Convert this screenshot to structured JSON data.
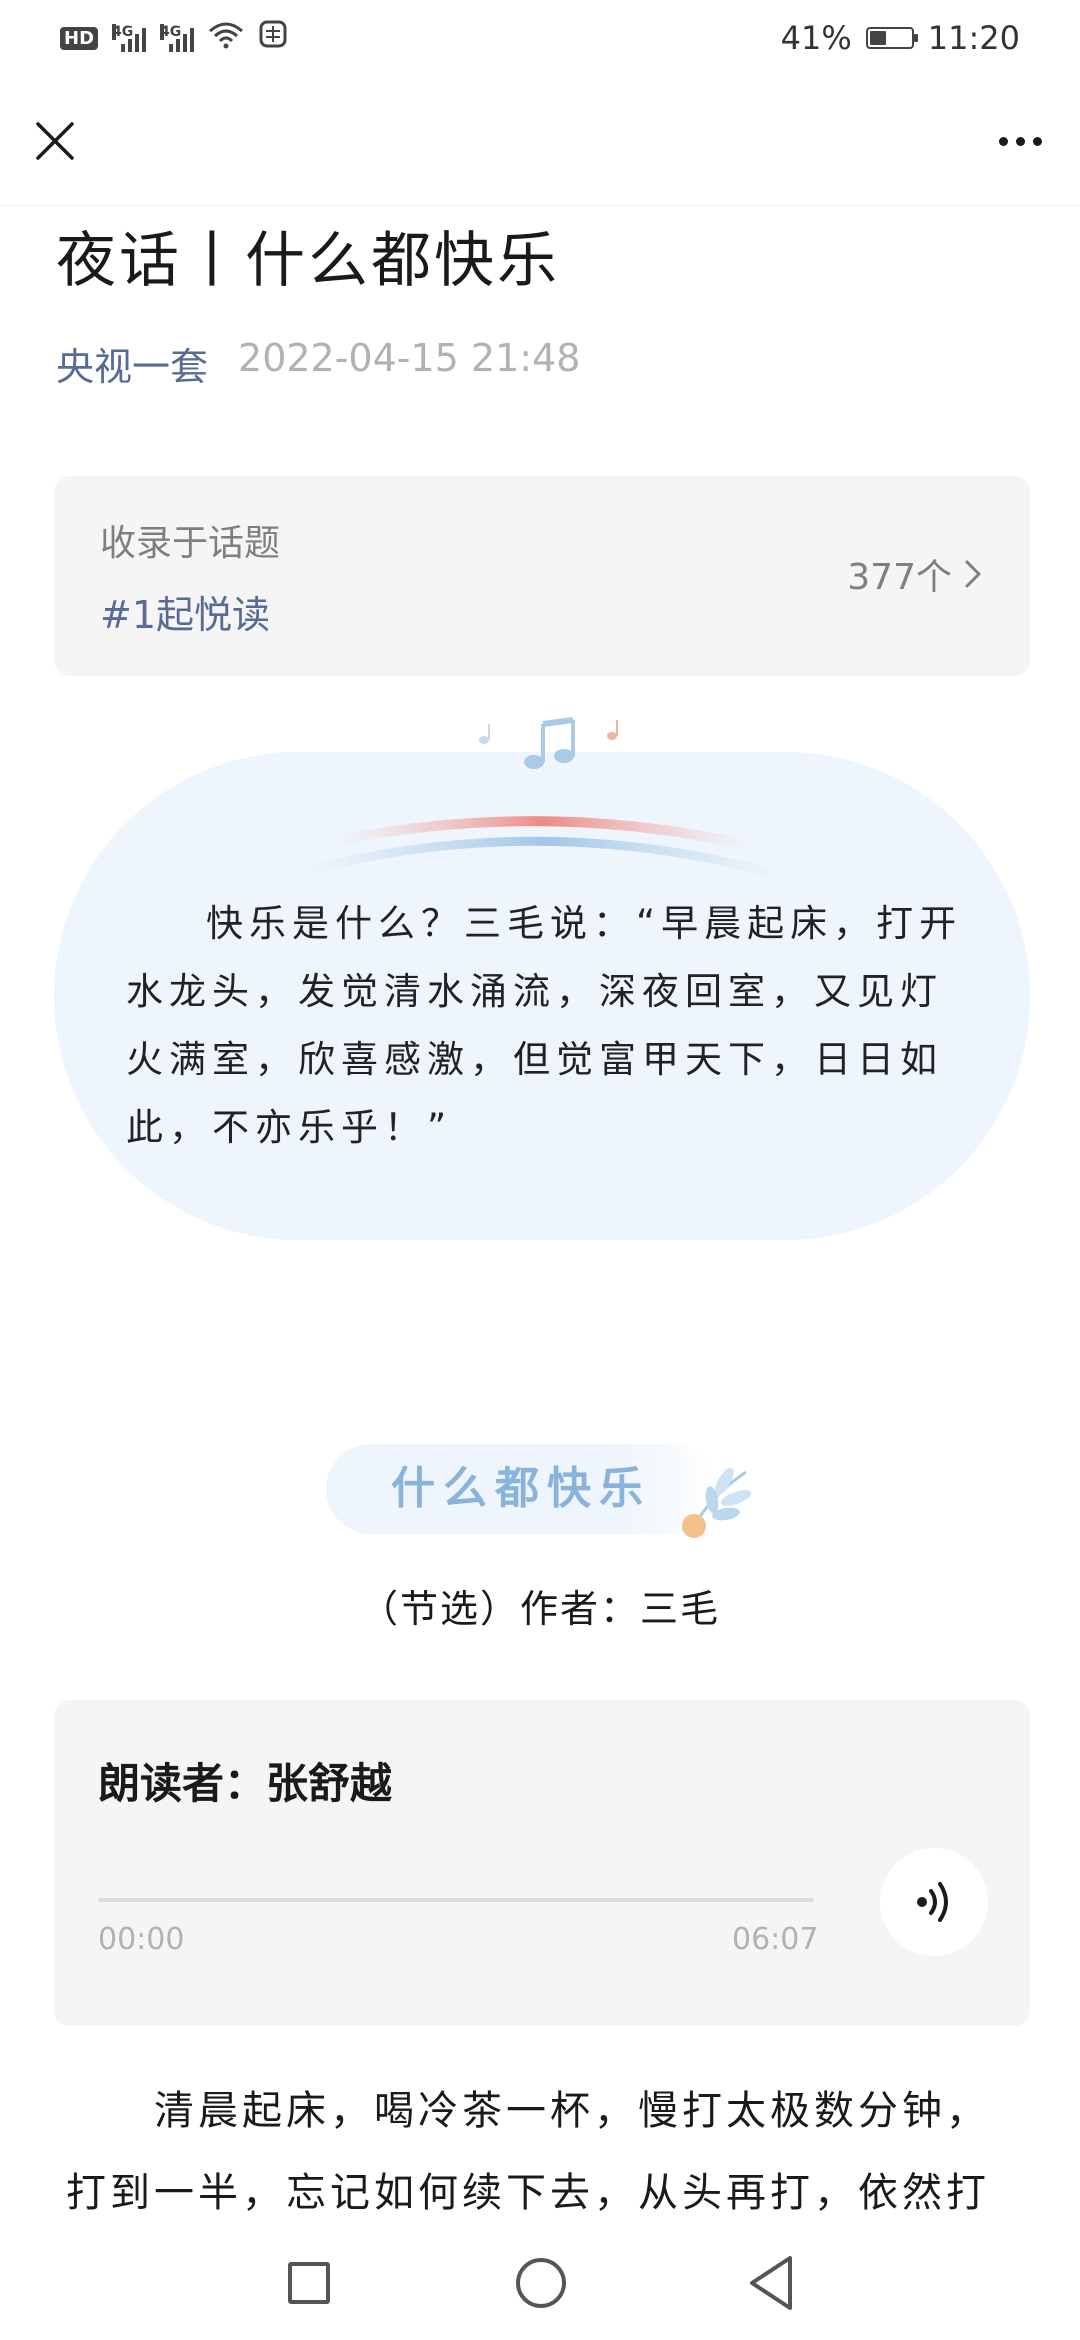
{
  "status_bar": {
    "hd_label": "HD",
    "network_1": "4G",
    "network_2": "4G",
    "battery_percent": "41%",
    "battery_level": 0.41,
    "time": "11:20",
    "icons": [
      "hd-icon",
      "signal-icon",
      "signal-icon",
      "wifi-icon",
      "sim-icon",
      "battery-icon"
    ]
  },
  "nav": {
    "close_icon": "close-icon",
    "more_icon": "more-icon"
  },
  "article": {
    "title": "夜话丨什么都快乐",
    "author": "央视一套",
    "date": "2022-04-15 21:48"
  },
  "topic": {
    "label": "收录于话题",
    "name": "#1起悦读",
    "count": "377个"
  },
  "quote": {
    "text": "快乐是什么？三毛说：“早晨起床，打开水龙头，发觉清水涌流，深夜回室，又见灯火满室，欣喜感激，但觉富甲天下，日日如此，不亦乐乎！”"
  },
  "poem": {
    "title": "什么都快乐",
    "subtitle": "（节选）作者：三毛"
  },
  "audio": {
    "reader": "朗读者：张舒越",
    "current_time": "00:00",
    "total_time": "06:07",
    "progress": 0,
    "play_icon": "audio-play-icon"
  },
  "body": {
    "text": "清晨起床，喝冷茶一杯，慢打太极数分钟，打到一半，忘记如何续下去，从头再打，依然打不下"
  },
  "system_nav": {
    "icons": [
      "recents-icon",
      "home-icon",
      "back-icon"
    ]
  },
  "colors": {
    "link": "#576b95",
    "meta_gray": "#b2b2b2",
    "card_bg": "#f5f5f5",
    "bubble_bg": "#eef5fc",
    "poem_title": "#8ab3dc"
  }
}
